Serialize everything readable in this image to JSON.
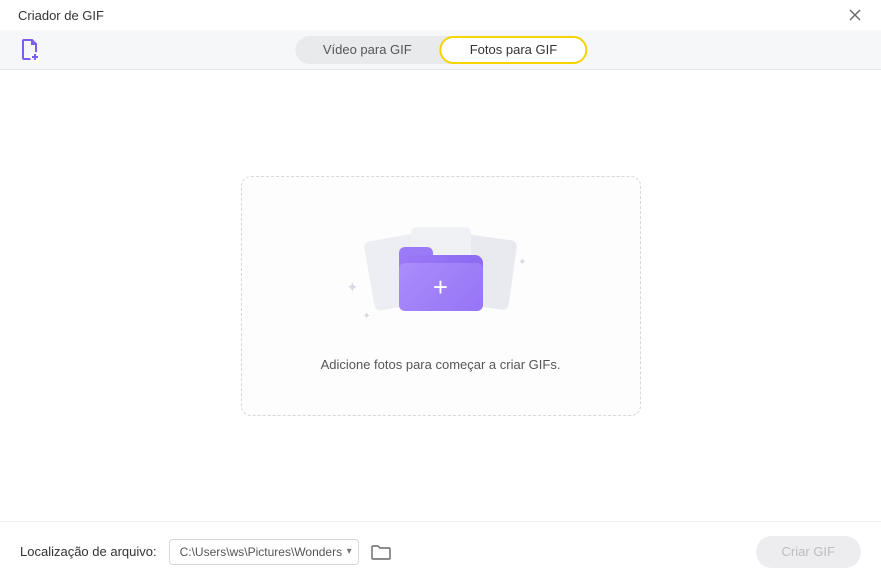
{
  "window": {
    "title": "Criador de GIF"
  },
  "toolbar": {
    "tabs": {
      "video": "Vídeo para GIF",
      "photos": "Fotos para GIF"
    }
  },
  "dropzone": {
    "hint": "Adicione fotos para começar a criar GIFs."
  },
  "footer": {
    "location_label": "Localização de arquivo:",
    "path": "C:\\Users\\ws\\Pictures\\Wonders",
    "create_label": "Criar GIF"
  }
}
